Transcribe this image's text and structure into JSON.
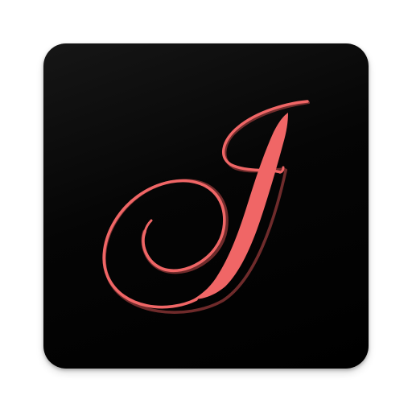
{
  "app_icon": {
    "glyph_icon": "script-letter-j-icon",
    "colors": {
      "tile_background": "#000000",
      "tile_highlight": "#161616",
      "glyph": "#f06666",
      "glyph_shadow": "#c84c4c"
    }
  }
}
